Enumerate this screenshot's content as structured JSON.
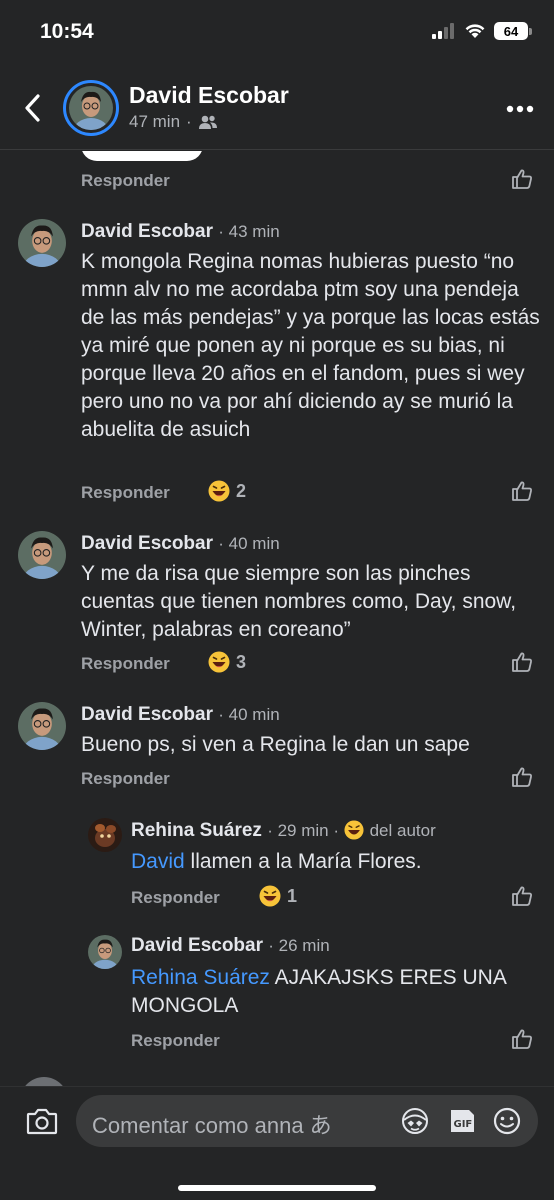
{
  "status": {
    "time": "10:54",
    "battery": "64"
  },
  "header": {
    "name": "David Escobar",
    "time": "47 min"
  },
  "feed": {
    "top_reply_label": "Responder",
    "comments": [
      {
        "author": "David Escobar",
        "time": "· 43 min",
        "text": "K mongola Regina nomas hubieras puesto “no mmn alv no me acordaba ptm soy una pendeja de las más pendejas” y ya porque las locas estás ya miré que ponen ay ni porque es su bias, ni porque lleva 20 años en el fandom, pues si wey pero uno no va por ahí diciendo ay se murió la abuelita de asuich",
        "reply_label": "Responder",
        "reaction_count": "2"
      },
      {
        "author": "David Escobar",
        "time": "· 40 min",
        "text": "Y me da risa que siempre son las pinches cuentas que tienen nombres como, Day, snow, Winter, palabras en coreano”",
        "reply_label": "Responder",
        "reaction_count": "3"
      },
      {
        "author": "David Escobar",
        "time": "· 40 min",
        "text": "Bueno ps, si ven a Regina le dan un sape",
        "reply_label": "Responder"
      }
    ],
    "replies": [
      {
        "author": "Rehina Suárez",
        "time": "· 29 min ·",
        "badge": "del autor",
        "mention": "David",
        "text": " llamen a la María Flores.",
        "reply_label": "Responder",
        "reaction_count": "1"
      },
      {
        "author": "David Escobar",
        "time": "· 26 min",
        "mention": "Rehina Suárez",
        "text": " AJAKAJSKS ERES UNA MONGOLA",
        "reply_label": "Responder"
      }
    ]
  },
  "compose": {
    "placeholder": "Comentar como anna あ"
  },
  "colors": {
    "background": "#242526",
    "accent": "#2d88ff",
    "mention": "#4599ff"
  }
}
